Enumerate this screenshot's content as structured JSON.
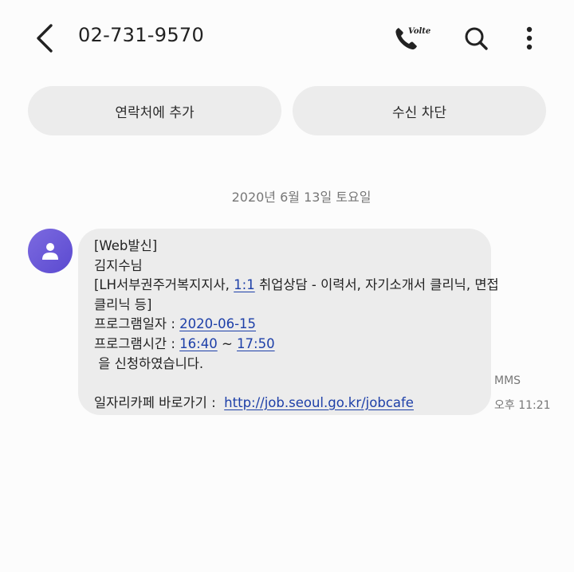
{
  "header": {
    "phone_number": "02-731-9570",
    "volte_label": "Volte",
    "icons": [
      "back-arrow-icon",
      "phone-icon",
      "search-icon",
      "more-vertical-icon"
    ]
  },
  "actions": {
    "add_contact": "연락처에 추가",
    "block": "수신 차단"
  },
  "conversation": {
    "date": "2020년 6월 13일 토요일",
    "message": {
      "line1": "[Web발신]",
      "line2": "김지수님",
      "line3_prefix": "[LH서부권주거복지지사, ",
      "line3_link": "1:1",
      "line3_suffix": " 취업상담 - 이력서, 자기소개서 클리닉, 면접",
      "line4": "클리닉 등]",
      "line5_prefix": "프로그램일자 : ",
      "program_date": "2020-06-15",
      "line6_prefix": "프로그램시간 : ",
      "time_start": "16:40",
      "time_sep": " ~ ",
      "time_end": "17:50",
      "line7": " 을 신청하였습니다.",
      "line9_prefix": "일자리카페 바로가기 :  ",
      "url": "http://job.seoul.go.kr/jobcafe"
    },
    "type_label": "MMS",
    "time": "오후 11:21"
  },
  "colors": {
    "background": "#fcfcfc",
    "bubble": "#ececec",
    "link": "#1d3fa8",
    "avatar": "#6a58d8"
  }
}
